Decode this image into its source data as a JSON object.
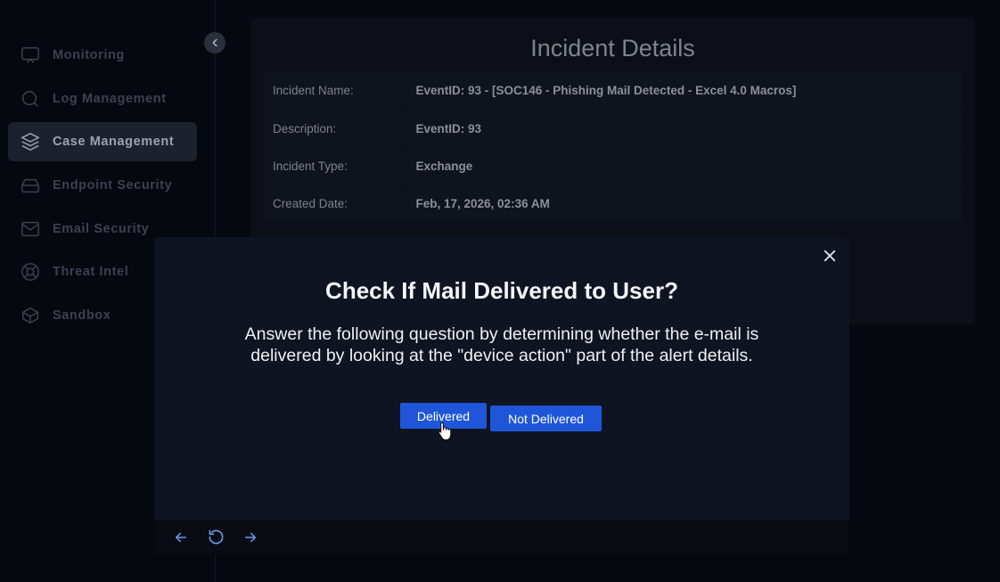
{
  "sidebar": {
    "items": [
      {
        "label": "Monitoring",
        "icon": "monitor-icon",
        "active": false
      },
      {
        "label": "Log Management",
        "icon": "search-icon",
        "active": false
      },
      {
        "label": "Case Management",
        "icon": "layers-icon",
        "active": true
      },
      {
        "label": "Endpoint Security",
        "icon": "hard-drive-icon",
        "active": false
      },
      {
        "label": "Email Security",
        "icon": "mail-icon",
        "active": false
      },
      {
        "label": "Threat Intel",
        "icon": "lifebuoy-icon",
        "active": false
      },
      {
        "label": "Sandbox",
        "icon": "box-icon",
        "active": false
      }
    ]
  },
  "incident": {
    "title": "Incident Details",
    "rows": [
      {
        "key": "Incident Name:",
        "value": "EventID: 93 - [SOC146 - Phishing Mail Detected - Excel 4.0 Macros]"
      },
      {
        "key": "Description:",
        "value": "EventID: 93"
      },
      {
        "key": "Incident Type:",
        "value": "Exchange"
      },
      {
        "key": "Created Date:",
        "value": "Feb, 17, 2026, 02:36 AM"
      }
    ]
  },
  "modal": {
    "title": "Check If Mail Delivered to User?",
    "text": "Answer the following question by determining whether the e-mail is delivered by looking at the \"device action\" part of the alert details.",
    "buttons": {
      "delivered": "Delivered",
      "not_delivered": "Not Delivered"
    }
  },
  "colors": {
    "accent": "#1f56d9",
    "background": "#06080f",
    "modal_background": "#0e1421"
  }
}
